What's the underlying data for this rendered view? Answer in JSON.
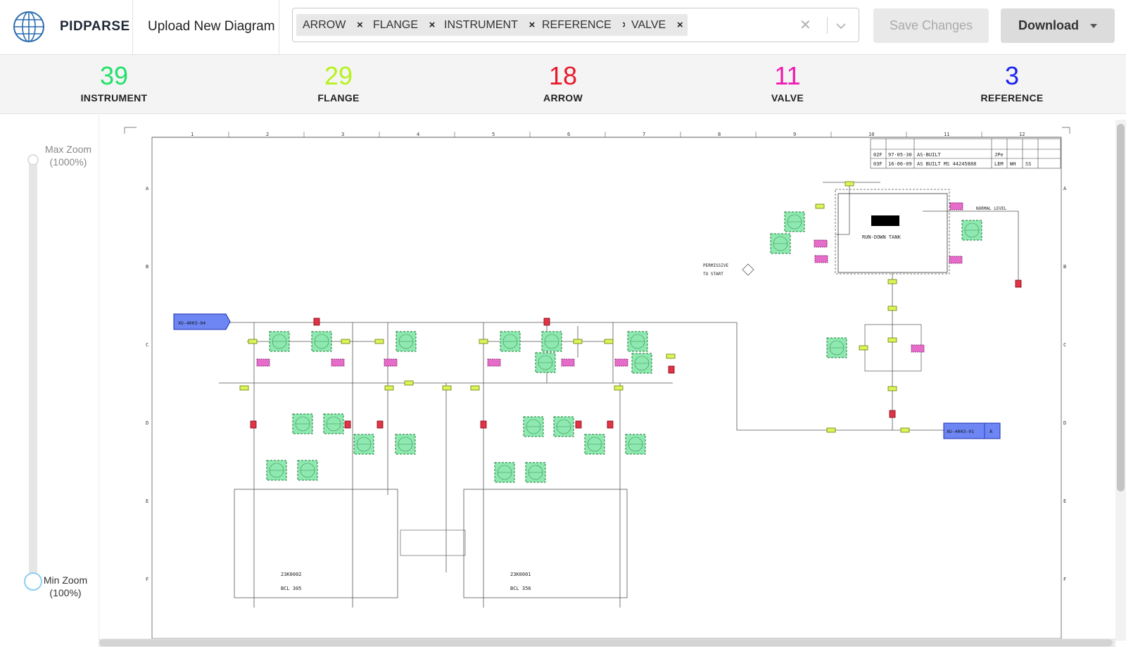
{
  "header": {
    "brand": "PIDPARSE",
    "upload_label": "Upload New Diagram",
    "tags": [
      "ARROW",
      "FLANGE",
      "INSTRUMENT",
      "REFERENCE",
      "VALVE"
    ],
    "save_label": "Save Changes",
    "download_label": "Download"
  },
  "stats": [
    {
      "count": "39",
      "label": "INSTRUMENT",
      "color": "#22e06a"
    },
    {
      "count": "29",
      "label": "FLANGE",
      "color": "#b6f21a"
    },
    {
      "count": "18",
      "label": "ARROW",
      "color": "#e8192c"
    },
    {
      "count": "11",
      "label": "VALVE",
      "color": "#ee18b0"
    },
    {
      "count": "3",
      "label": "REFERENCE",
      "color": "#1c23ee"
    }
  ],
  "zoom": {
    "max_label": "Max Zoom (1000%)",
    "min_label": "Min Zoom (100%)"
  },
  "diagram": {
    "col_labels": [
      "1",
      "2",
      "3",
      "4",
      "5",
      "6",
      "7",
      "8",
      "9",
      "10",
      "11",
      "12"
    ],
    "row_labels": [
      "A",
      "B",
      "C",
      "D",
      "E",
      "F"
    ],
    "tank_label": "RUN-DOWN TANK",
    "normal_level": "NORMAL LEVEL",
    "permissive": "PERMISSIVE",
    "to_start": "TO START",
    "ref_left": "XU-4003-04",
    "ref_right": "XU-4003-01",
    "ref_right_tag": "A",
    "machine_left": "23K0002",
    "machine_left_sub": "BCL 305",
    "machine_right": "23K0001",
    "machine_right_sub": "BCL 356",
    "revisions": [
      {
        "rev": "02F",
        "date": "97-05-30",
        "desc": "AS-BUILT",
        "by": "JPe"
      },
      {
        "rev": "03F",
        "date": "16-06-09",
        "desc": "AS BUILT MS 44245888",
        "by": "LEM",
        "chk": "WH",
        "app": "SS"
      }
    ]
  }
}
